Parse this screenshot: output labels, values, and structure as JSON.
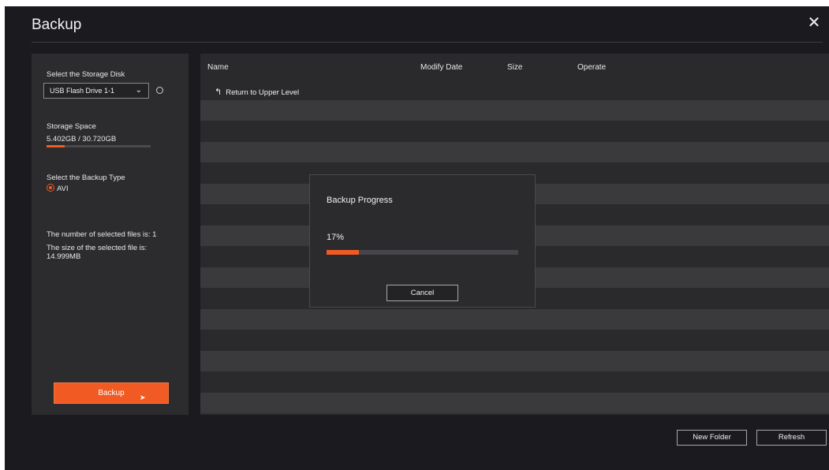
{
  "window": {
    "title": "Backup",
    "close_icon": "close-icon"
  },
  "left_panel": {
    "disk_label": "Select the Storage Disk",
    "disk_selected": "USB Flash Drive 1-1",
    "storage_label": "Storage Space",
    "storage_value": "5.402GB / 30.720GB",
    "storage_used_fraction": 0.176,
    "backup_type_label": "Select the Backup Type",
    "backup_type_option": "AVI",
    "selected_count_text": "The number of selected files is: 1",
    "selected_size_label": "The size of the selected file is:",
    "selected_size_value": "14.999MB",
    "backup_button": "Backup"
  },
  "table": {
    "columns": [
      "Name",
      "Modify Date",
      "Size",
      "Operate"
    ],
    "return_label": "Return to Upper Level"
  },
  "modal": {
    "title": "Backup Progress",
    "percent_text": "17%",
    "progress_fraction": 0.17,
    "cancel_button": "Cancel"
  },
  "footer": {
    "new_folder_button": "New Folder",
    "refresh_button": "Refresh"
  },
  "colors": {
    "accent": "#f15a22",
    "background": "#1b1b1f",
    "panel": "#2c2c2f"
  }
}
